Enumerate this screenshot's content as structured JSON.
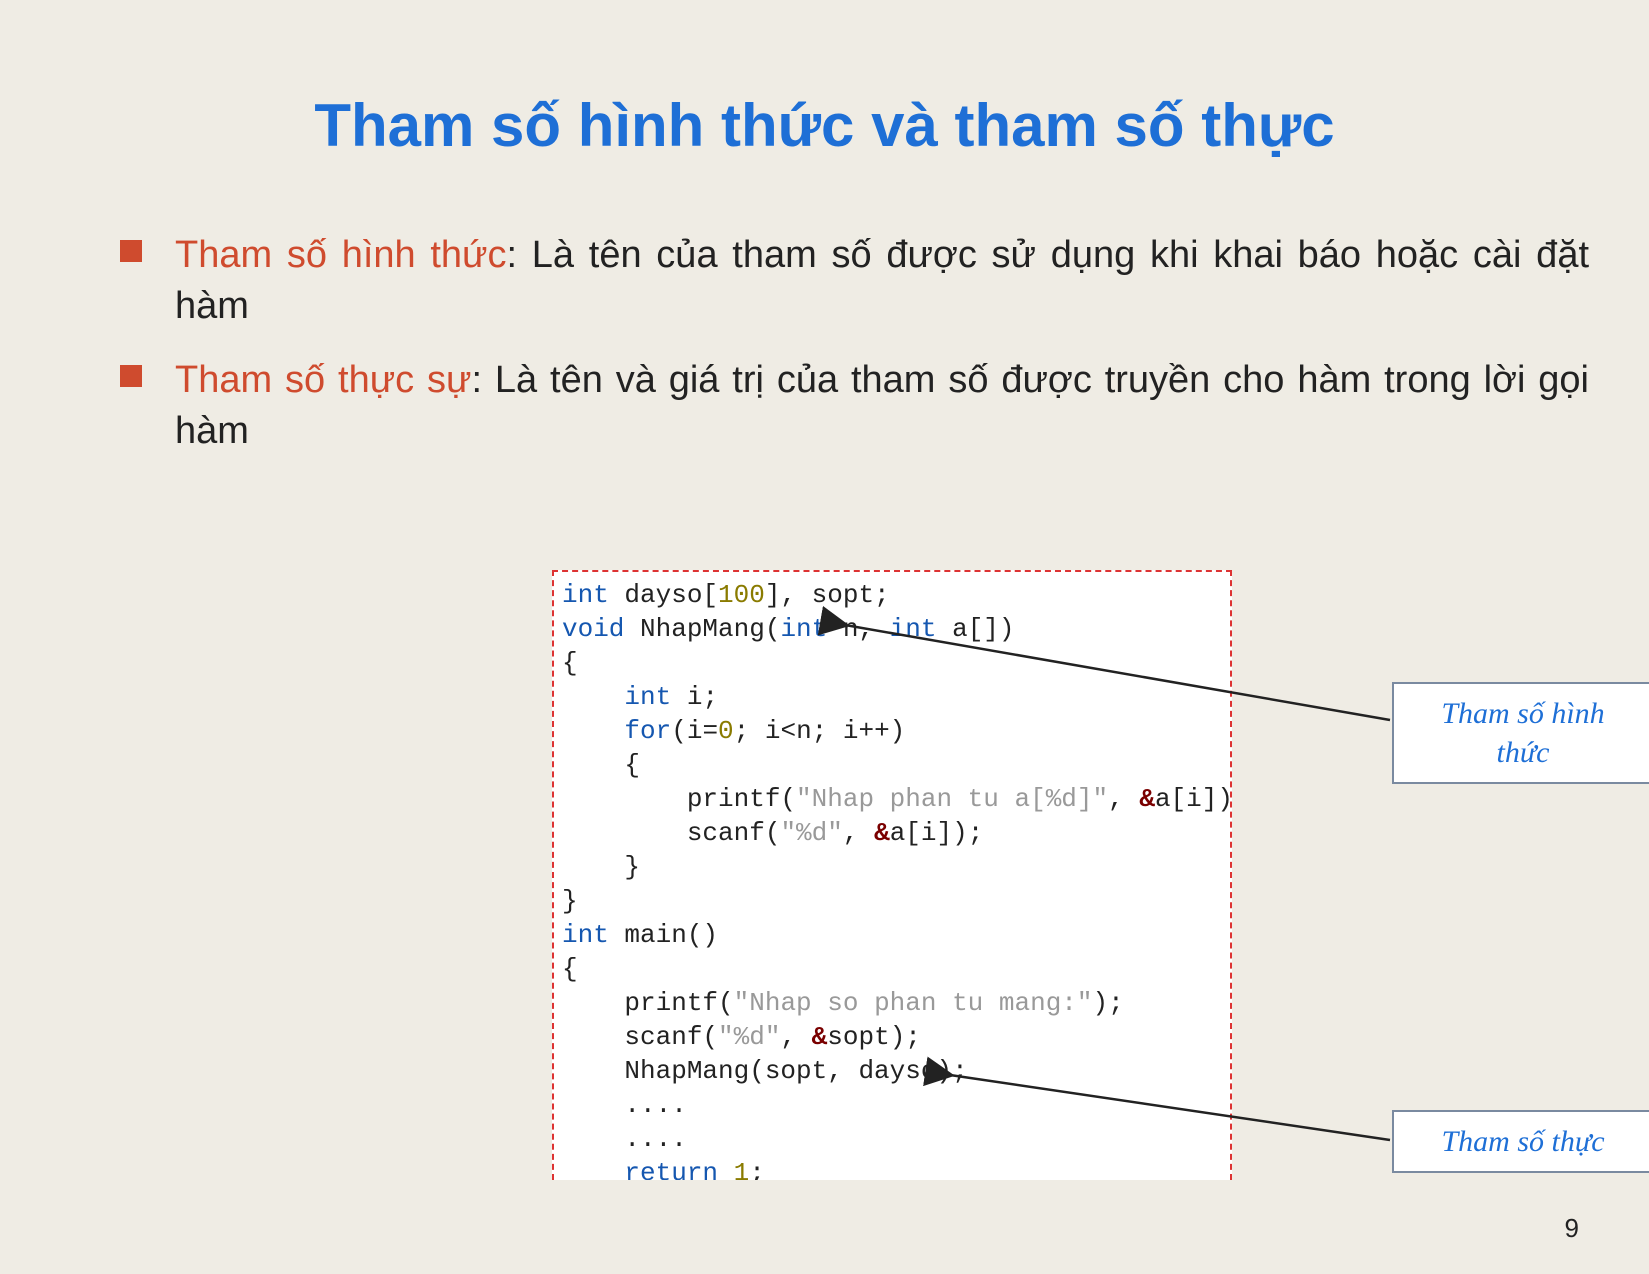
{
  "title": "Tham số hình thức và tham số thực",
  "bullets": [
    {
      "highlight": "Tham số hình thức",
      "rest": ": Là tên của tham số được sử dụng khi khai báo hoặc cài đặt hàm"
    },
    {
      "highlight": "Tham số thực sự",
      "rest": ": Là tên và giá trị của tham số được truyền cho hàm trong lời gọi hàm"
    }
  ],
  "code": {
    "l01_int": "int",
    "l01_rest_a": " dayso[",
    "l01_num": "100",
    "l01_rest_b": "], sopt;",
    "l02_void": "void",
    "l02_rest_a": " NhapMang(",
    "l02_int1": "int",
    "l02_mid": " n, ",
    "l02_int2": "int",
    "l02_rest_b": " a[])",
    "l03": "{",
    "l04_int": "int",
    "l04_rest": " i;",
    "l05_for": "for",
    "l05_a": "(i=",
    "l05_zero": "0",
    "l05_b": "; i<n; i++)",
    "l06": "    {",
    "l07_a": "        printf(",
    "l07_str": "\"Nhap phan tu a[%d]\"",
    "l07_b": ", ",
    "l07_amp": "&",
    "l07_c": "a[i]);",
    "l08_a": "        scanf(",
    "l08_str": "\"%d\"",
    "l08_b": ", ",
    "l08_amp": "&",
    "l08_c": "a[i]);",
    "l09": "    }",
    "l10": "}",
    "l11_int": "int",
    "l11_rest": " main()",
    "l12": "{",
    "l13_a": "    printf(",
    "l13_str": "\"Nhap so phan tu mang:\"",
    "l13_b": ");",
    "l14_a": "    scanf(",
    "l14_str": "\"%d\"",
    "l14_b": ", ",
    "l14_amp": "&",
    "l14_c": "sopt);",
    "l15": "    NhapMang(sopt, dayso);",
    "l16": "    ....",
    "l17": "    ....",
    "l18_ret": "return",
    "l18_sp": " ",
    "l18_one": "1",
    "l18_semi": ";"
  },
  "callout1_line1": "Tham số hình",
  "callout1_line2": "thức",
  "callout2": "Tham số thực",
  "page_number": "9"
}
